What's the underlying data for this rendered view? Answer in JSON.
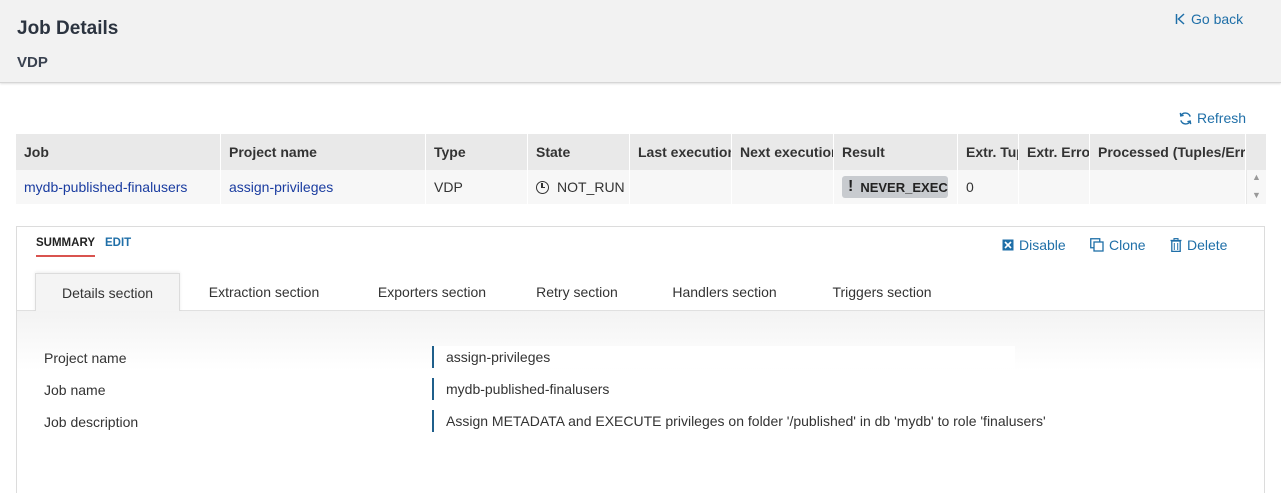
{
  "header": {
    "title": "Job Details",
    "subtitle": "VDP",
    "go_back": "Go back"
  },
  "toolbar": {
    "refresh": "Refresh"
  },
  "table": {
    "columns": [
      "Job",
      "Project name",
      "Type",
      "State",
      "Last execution",
      "Next execution",
      "Result",
      "Extr. Tup",
      "Extr. Errors",
      "Processed (Tuples/Errors)"
    ],
    "rows": [
      {
        "job": "mydb-published-finalusers",
        "project": "assign-privileges",
        "type": "VDP",
        "state": "NOT_RUN",
        "last_execution": "",
        "next_execution": "",
        "result": "NEVER_EXECUTED",
        "extr_tuples": "0",
        "extr_errors": "",
        "processed": ""
      }
    ]
  },
  "panel": {
    "modes": {
      "summary": "SUMMARY",
      "edit": "EDIT"
    },
    "actions": {
      "disable": "Disable",
      "clone": "Clone",
      "delete": "Delete"
    },
    "tabs": [
      "Details section",
      "Extraction section",
      "Exporters section",
      "Retry section",
      "Handlers section",
      "Triggers section"
    ],
    "active_tab": "Details section",
    "details": [
      {
        "label": "Project name",
        "value": "assign-privileges"
      },
      {
        "label": "Job name",
        "value": "mydb-published-finalusers"
      },
      {
        "label": "Job description",
        "value": "Assign METADATA and EXECUTE privileges on folder '/published' in db 'mydb' to role 'finalusers'"
      }
    ]
  },
  "colors": {
    "link": "#1f6fa8",
    "job_link": "#1a3ca0",
    "summary_underline": "#d9534f",
    "header_bg": "#f2f2f2",
    "result_badge": "#c8cbcf"
  }
}
